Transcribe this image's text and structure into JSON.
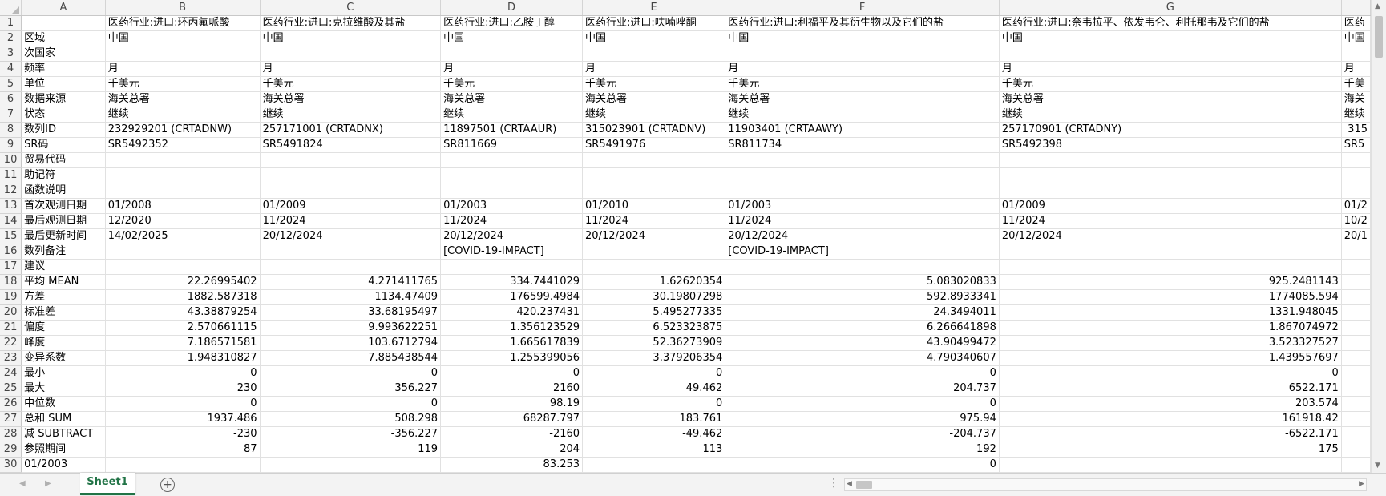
{
  "columns": [
    "A",
    "B",
    "C",
    "D",
    "E",
    "F",
    "G",
    ""
  ],
  "rows": [
    [
      "",
      "医药行业:进口:环丙氟哌酸",
      "医药行业:进口:克拉维酸及其盐",
      "医药行业:进口:乙胺丁醇",
      "医药行业:进口:呋喃唑酮",
      "医药行业:进口:利福平及其衍生物以及它们的盐",
      "医药行业:进口:奈韦拉平、依发韦仑、利托那韦及它们的盐",
      "医药"
    ],
    [
      "区域",
      "中国",
      "中国",
      "中国",
      "中国",
      "中国",
      "中国",
      "中国"
    ],
    [
      "次国家",
      "",
      "",
      "",
      "",
      "",
      "",
      ""
    ],
    [
      "频率",
      "月",
      "月",
      "月",
      "月",
      "月",
      "月",
      "月"
    ],
    [
      "单位",
      "千美元",
      "千美元",
      "千美元",
      "千美元",
      "千美元",
      "千美元",
      "千美"
    ],
    [
      "数据来源",
      "海关总署",
      "海关总署",
      "海关总署",
      "海关总署",
      "海关总署",
      "海关总署",
      "海关"
    ],
    [
      "状态",
      "继续",
      "继续",
      "继续",
      "继续",
      "继续",
      "继续",
      "继续"
    ],
    [
      "数列ID",
      "232929201 (CRTADNW)",
      "257171001 (CRTADNX)",
      "11897501 (CRTAAUR)",
      "315023901 (CRTADNV)",
      "11903401 (CRTAAWY)",
      "257170901 (CRTADNY)",
      "315"
    ],
    [
      "SR码",
      "SR5492352",
      "SR5491824",
      "SR811669",
      "SR5491976",
      "SR811734",
      "SR5492398",
      "SR5"
    ],
    [
      "贸易代码",
      "",
      "",
      "",
      "",
      "",
      "",
      ""
    ],
    [
      "助记符",
      "",
      "",
      "",
      "",
      "",
      "",
      ""
    ],
    [
      "函数说明",
      "",
      "",
      "",
      "",
      "",
      "",
      ""
    ],
    [
      "首次观测日期",
      "01/2008",
      "01/2009",
      "01/2003",
      "01/2010",
      "01/2003",
      "01/2009",
      "01/2"
    ],
    [
      "最后观测日期",
      "12/2020",
      "11/2024",
      "11/2024",
      "11/2024",
      "11/2024",
      "11/2024",
      "10/2"
    ],
    [
      "最后更新时间",
      "14/02/2025",
      "20/12/2024",
      "20/12/2024",
      "20/12/2024",
      "20/12/2024",
      "20/12/2024",
      "20/1"
    ],
    [
      "数列备注",
      "",
      "",
      "[COVID-19-IMPACT]",
      "",
      "[COVID-19-IMPACT]",
      "",
      ""
    ],
    [
      "建议",
      "",
      "",
      "",
      "",
      "",
      "",
      ""
    ],
    [
      "平均 MEAN",
      "22.26995402",
      "4.271411765",
      "334.7441029",
      "1.62620354",
      "5.083020833",
      "925.2481143",
      ""
    ],
    [
      "方差",
      "1882.587318",
      "1134.47409",
      "176599.4984",
      "30.19807298",
      "592.8933341",
      "1774085.594",
      ""
    ],
    [
      "标准差",
      "43.38879254",
      "33.68195497",
      "420.237431",
      "5.495277335",
      "24.3494011",
      "1331.948045",
      ""
    ],
    [
      "偏度",
      "2.570661115",
      "9.993622251",
      "1.356123529",
      "6.523323875",
      "6.266641898",
      "1.867074972",
      ""
    ],
    [
      "峰度",
      "7.186571581",
      "103.6712794",
      "1.665617839",
      "52.36273909",
      "43.90499472",
      "3.523327527",
      ""
    ],
    [
      "变异系数",
      "1.948310827",
      "7.885438544",
      "1.255399056",
      "3.379206354",
      "4.790340607",
      "1.439557697",
      ""
    ],
    [
      "最小",
      "0",
      "0",
      "0",
      "0",
      "0",
      "0",
      ""
    ],
    [
      "最大",
      "230",
      "356.227",
      "2160",
      "49.462",
      "204.737",
      "6522.171",
      ""
    ],
    [
      "中位数",
      "0",
      "0",
      "98.19",
      "0",
      "0",
      "203.574",
      ""
    ],
    [
      "总和 SUM",
      "1937.486",
      "508.298",
      "68287.797",
      "183.761",
      "975.94",
      "161918.42",
      ""
    ],
    [
      "减 SUBTRACT",
      "-230",
      "-356.227",
      "-2160",
      "-49.462",
      "-204.737",
      "-6522.171",
      ""
    ],
    [
      "参照期间",
      "87",
      "119",
      "204",
      "113",
      "192",
      "175",
      ""
    ],
    [
      "01/2003",
      "",
      "",
      "83.253",
      "",
      "0",
      "",
      ""
    ]
  ],
  "sheet_tab": "Sheet1",
  "add_sheet_icon": "+",
  "accent_color": "#217346"
}
